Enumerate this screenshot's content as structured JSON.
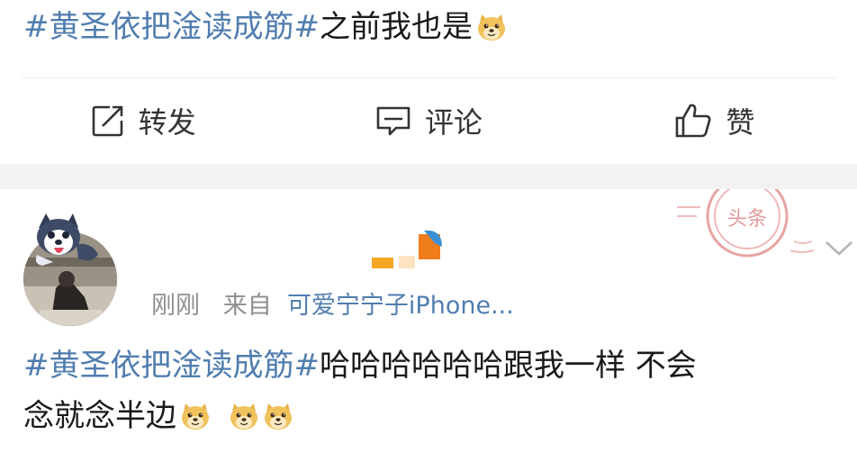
{
  "top_post": {
    "hashtag": "#黄圣依把淦读成筋#",
    "text": "之前我也是",
    "emoji": "doge-icon"
  },
  "actions": {
    "repost_label": "转发",
    "comment_label": "评论",
    "like_label": "赞"
  },
  "comment": {
    "time": "刚刚",
    "from_prefix": "来自",
    "source": "可爱宁宁子iPhone...",
    "stamp_text": "头条",
    "hashtag": "#黄圣依把淦读成筋#",
    "text_line1": "哈哈哈哈哈哈跟我一样 不会",
    "text_line2": "念就念半边"
  },
  "colors": {
    "link": "#507daf",
    "band": "#f2f2f2"
  }
}
